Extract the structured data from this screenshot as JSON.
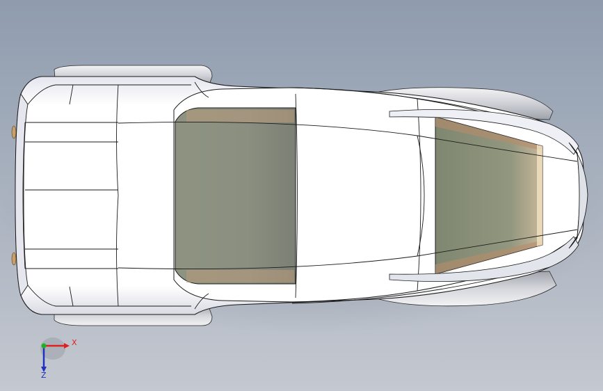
{
  "viewport": {
    "background_top": "#909db0",
    "background_bottom": "#c2c7cf"
  },
  "model": {
    "body_color": "#ffffff",
    "edge_color": "#1a1a1a",
    "glass_color": "#8d9283",
    "glass_tint_edge": "#b48a6a"
  },
  "triad": {
    "x_label": "X",
    "z_label": "Z",
    "x_color": "#e02020",
    "y_color": "#20b020",
    "z_color": "#2030c0"
  }
}
